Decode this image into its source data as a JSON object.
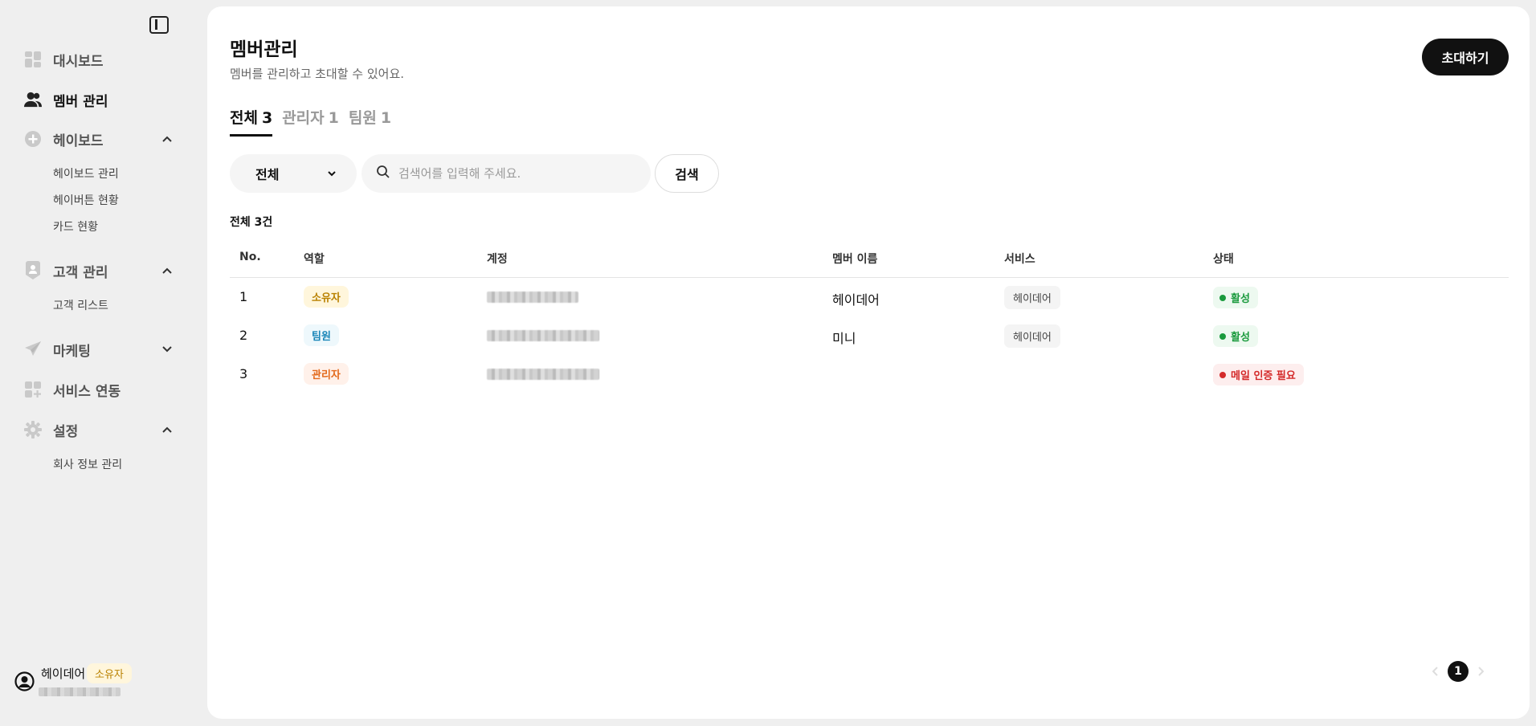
{
  "sidebar": {
    "items": [
      {
        "label": "대시보드",
        "icon": "dashboard-icon"
      },
      {
        "label": "멤버 관리",
        "icon": "members-icon",
        "active": true
      },
      {
        "label": "헤이보드",
        "icon": "plus-circle-icon",
        "expanded": true,
        "children": [
          {
            "label": "헤이보드 관리"
          },
          {
            "label": "헤이버튼 현황"
          },
          {
            "label": "카드 현황"
          }
        ]
      },
      {
        "label": "고객 관리",
        "icon": "customer-icon",
        "expanded": true,
        "children": [
          {
            "label": "고객 리스트"
          }
        ]
      },
      {
        "label": "마케팅",
        "icon": "rocket-icon",
        "expanded": false
      },
      {
        "label": "서비스 연동",
        "icon": "integration-icon"
      },
      {
        "label": "설정",
        "icon": "gear-icon",
        "expanded": true,
        "children": [
          {
            "label": "회사 정보 관리"
          }
        ]
      }
    ],
    "profile": {
      "name": "헤이데어",
      "role": "소유자"
    }
  },
  "main": {
    "title": "멤버관리",
    "subtitle": "멤버를 관리하고 초대할 수 있어요.",
    "invite_label": "초대하기",
    "tabs": [
      {
        "label": "전체",
        "count": "3",
        "active": true
      },
      {
        "label": "관리자",
        "count": "1"
      },
      {
        "label": "팀원",
        "count": "1"
      }
    ],
    "filter": {
      "selected": "전체"
    },
    "search": {
      "placeholder": "검색어를 입력해 주세요.",
      "value": "",
      "button_label": "검색"
    },
    "total_label": "전체 3건",
    "table": {
      "headers": [
        "No.",
        "역할",
        "계정",
        "멤버 이름",
        "서비스",
        "상태"
      ],
      "rows": [
        {
          "no": "1",
          "role": "소유자",
          "member_name": "헤이데어",
          "service": "헤이데어",
          "status": "활성"
        },
        {
          "no": "2",
          "role": "팀원",
          "member_name": "미니",
          "service": "헤이데어",
          "status": "활성"
        },
        {
          "no": "3",
          "role": "관리자",
          "member_name": "",
          "service": "",
          "status": "메일 인증 필요"
        }
      ]
    },
    "pagination": {
      "current": "1"
    }
  },
  "colors": {
    "owner_bg": "#fff6dc",
    "owner_fg": "#b98100",
    "member_bg": "#eef8fc",
    "member_fg": "#1a86b8",
    "admin_bg": "#fff1ea",
    "admin_fg": "#e36a1c",
    "active_bg": "#edf9f0",
    "active_fg": "#1a9a3d",
    "pending_bg": "#fdeeee",
    "pending_fg": "#d42a2a"
  }
}
